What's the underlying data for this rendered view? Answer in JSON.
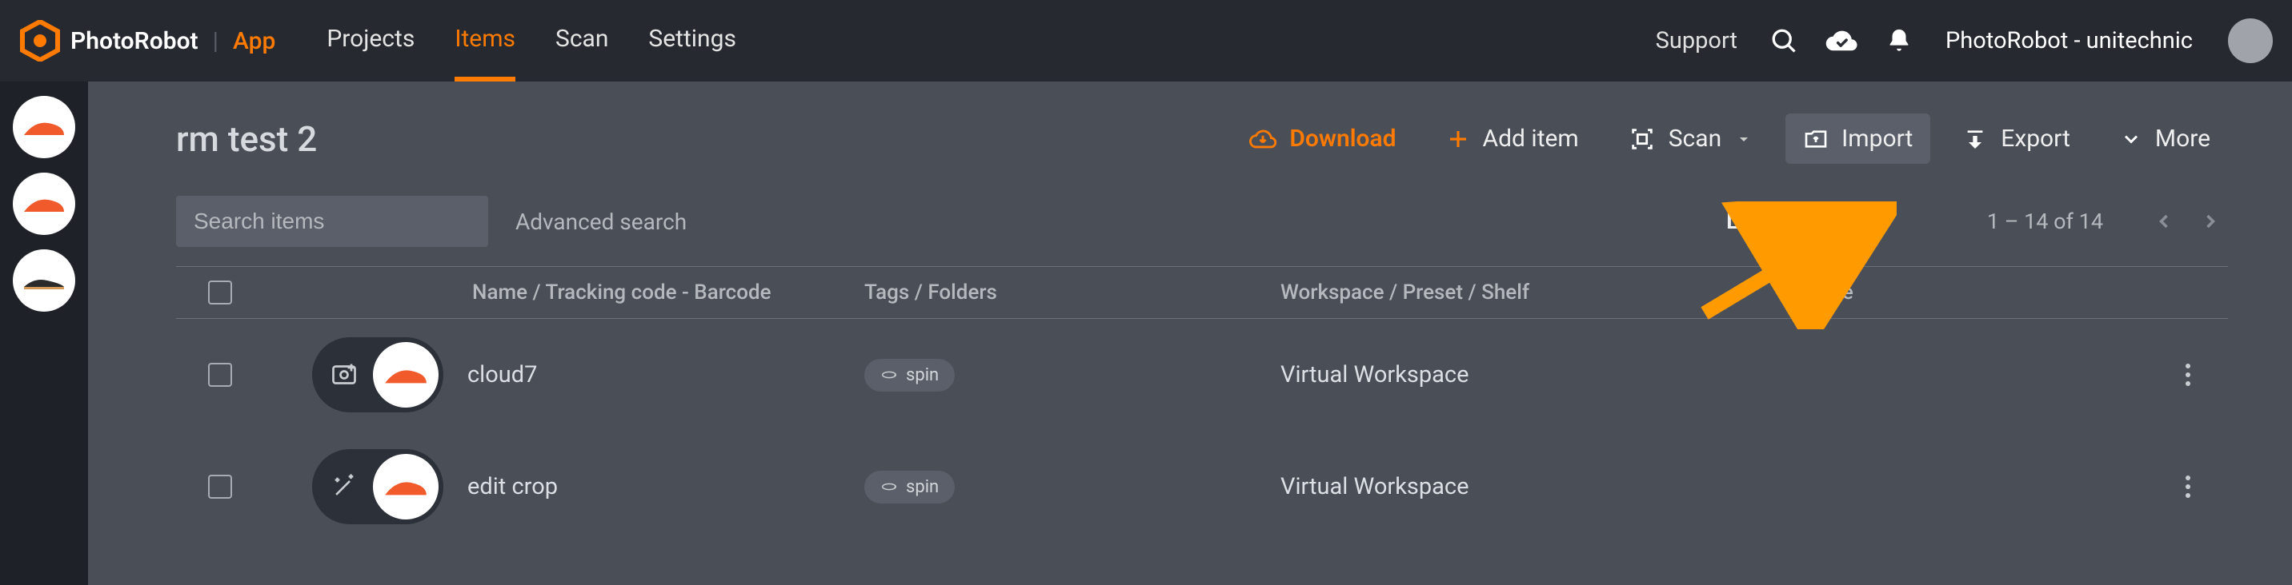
{
  "brand": {
    "name": "PhotoRobot",
    "app": "App"
  },
  "nav": {
    "projects": "Projects",
    "items": "Items",
    "scan": "Scan",
    "settings": "Settings"
  },
  "top": {
    "support": "Support",
    "user": "PhotoRobot - unitechnic"
  },
  "page": {
    "title": "rm test 2"
  },
  "actions": {
    "download": "Download",
    "add_item": "Add item",
    "scan": "Scan",
    "import": "Import",
    "export": "Export",
    "more": "More"
  },
  "search": {
    "placeholder": "Search items",
    "advanced": "Advanced search"
  },
  "sort": {
    "label": "Last modified"
  },
  "pager": {
    "range": "1 – 14 of 14"
  },
  "columns": {
    "name": "Name / Tracking code - Barcode",
    "tags": "Tags / Folders",
    "workspace": "Workspace / Preset / Shelf",
    "note": "Note"
  },
  "rows": [
    {
      "name": "cloud7",
      "tag": "spin",
      "workspace": "Virtual Workspace"
    },
    {
      "name": "edit crop",
      "tag": "spin",
      "workspace": "Virtual Workspace"
    }
  ]
}
